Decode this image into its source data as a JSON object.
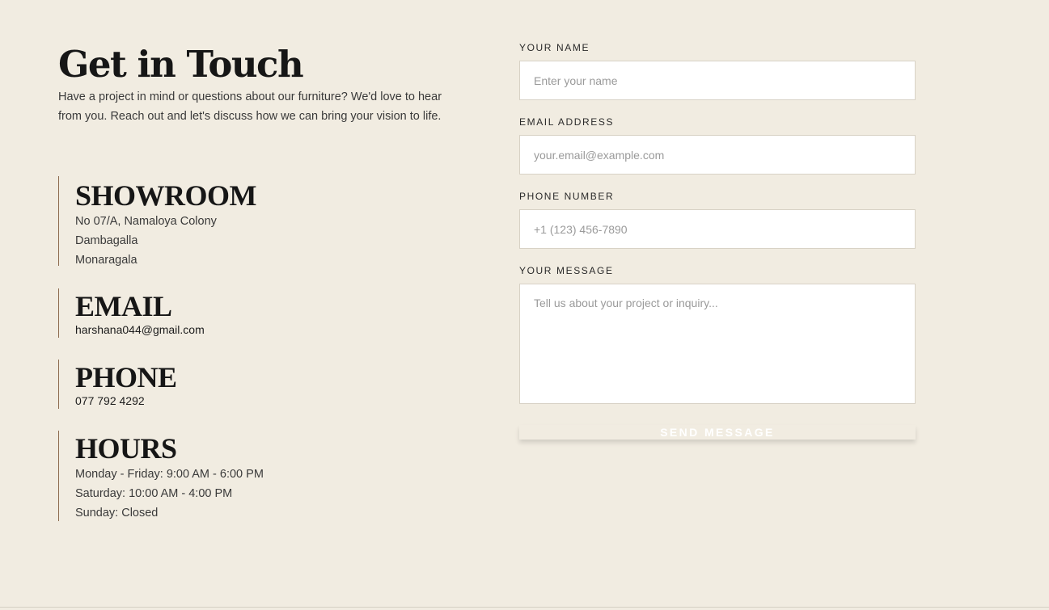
{
  "contact": {
    "title": "Get in Touch",
    "intro": "Have a project in mind or questions about our furniture? We'd love to hear from you. Reach out and let's discuss how we can bring your vision to life."
  },
  "showroom": {
    "heading": "SHOWROOM",
    "lines": [
      "No 07/A, Namaloya Colony",
      "Dambagalla",
      "Monaragala"
    ]
  },
  "email": {
    "heading": "EMAIL",
    "value": "harshana044@gmail.com"
  },
  "phone": {
    "heading": "PHONE",
    "value": "077 792 4292"
  },
  "hours": {
    "heading": "HOURS",
    "lines": [
      "Monday - Friday: 9:00 AM - 6:00 PM",
      "Saturday: 10:00 AM - 4:00 PM",
      "Sunday: Closed"
    ]
  },
  "form": {
    "name_label": "YOUR NAME",
    "name_placeholder": "Enter your name",
    "email_label": "EMAIL ADDRESS",
    "email_placeholder": "your.email@example.com",
    "phone_label": "PHONE NUMBER",
    "phone_placeholder": "+1 (123) 456-7890",
    "message_label": "YOUR MESSAGE",
    "message_placeholder": "Tell us about your project or inquiry...",
    "send_label": "SEND MESSAGE"
  },
  "colors": {
    "background": "#f1ece1",
    "accent_rule": "#8c6b4f",
    "heading": "#161616",
    "field_bg": "#ffffff"
  }
}
